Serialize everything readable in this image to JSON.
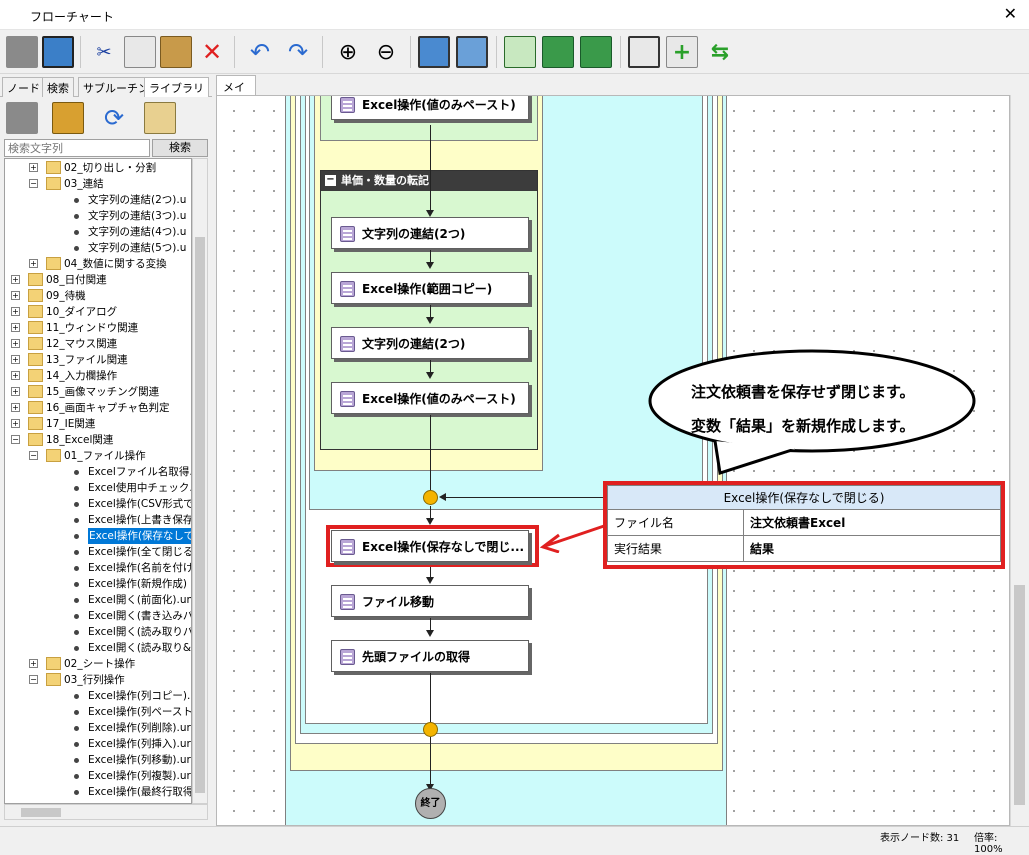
{
  "window": {
    "title": "フローチャート",
    "close": "✕"
  },
  "toolbar": {
    "icons": [
      "property-icon",
      "image-icon",
      "cut-icon",
      "copy-icon",
      "paste-icon",
      "delete-icon",
      "undo-icon",
      "redo-icon",
      "zoom-in-icon",
      "zoom-out-icon",
      "image-edit-icon",
      "image-swap-icon",
      "comment-icon",
      "export-icon",
      "import-icon",
      "window-icon",
      "add-node-icon",
      "swap-icon"
    ]
  },
  "left_tabs": [
    "ノード",
    "検索",
    "サブルーチン",
    "ライブラリ"
  ],
  "active_left_tab": "ライブラリ",
  "search": {
    "placeholder": "検索文字列",
    "button": "検索"
  },
  "tree": [
    {
      "d": 1,
      "t": "f",
      "e": "+",
      "l": "02_切り出し・分割"
    },
    {
      "d": 1,
      "t": "f",
      "e": "-",
      "l": "03_連結"
    },
    {
      "d": 2,
      "t": "n",
      "l": "文字列の連結(2つ).u"
    },
    {
      "d": 2,
      "t": "n",
      "l": "文字列の連結(3つ).u"
    },
    {
      "d": 2,
      "t": "n",
      "l": "文字列の連結(4つ).u"
    },
    {
      "d": 2,
      "t": "n",
      "l": "文字列の連結(5つ).u"
    },
    {
      "d": 1,
      "t": "f",
      "e": "+",
      "l": "04_数値に関する変換"
    },
    {
      "d": 0,
      "t": "f",
      "e": "+",
      "l": "08_日付関連"
    },
    {
      "d": 0,
      "t": "f",
      "e": "+",
      "l": "09_待機"
    },
    {
      "d": 0,
      "t": "f",
      "e": "+",
      "l": "10_ダイアログ"
    },
    {
      "d": 0,
      "t": "f",
      "e": "+",
      "l": "11_ウィンドウ関連"
    },
    {
      "d": 0,
      "t": "f",
      "e": "+",
      "l": "12_マウス関連"
    },
    {
      "d": 0,
      "t": "f",
      "e": "+",
      "l": "13_ファイル関連"
    },
    {
      "d": 0,
      "t": "f",
      "e": "+",
      "l": "14_入力欄操作"
    },
    {
      "d": 0,
      "t": "f",
      "e": "+",
      "l": "15_画像マッチング関連"
    },
    {
      "d": 0,
      "t": "f",
      "e": "+",
      "l": "16_画面キャプチャ色判定"
    },
    {
      "d": 0,
      "t": "f",
      "e": "+",
      "l": "17_IE関連"
    },
    {
      "d": 0,
      "t": "f",
      "e": "-",
      "l": "18_Excel関連"
    },
    {
      "d": 1,
      "t": "f",
      "e": "-",
      "l": "01_ファイル操作"
    },
    {
      "d": 2,
      "t": "n",
      "l": "Excelファイル名取得.ur"
    },
    {
      "d": 2,
      "t": "n",
      "l": "Excel使用中チェック.ur"
    },
    {
      "d": 2,
      "t": "n",
      "l": "Excel操作(CSV形式で"
    },
    {
      "d": 2,
      "t": "n",
      "l": "Excel操作(上書き保存"
    },
    {
      "d": 2,
      "t": "n",
      "l": "Excel操作(保存なしで",
      "sel": true
    },
    {
      "d": 2,
      "t": "n",
      "l": "Excel操作(全て閉じる)"
    },
    {
      "d": 2,
      "t": "n",
      "l": "Excel操作(名前を付け"
    },
    {
      "d": 2,
      "t": "n",
      "l": "Excel操作(新規作成)"
    },
    {
      "d": 2,
      "t": "n",
      "l": "Excel開く(前面化).um"
    },
    {
      "d": 2,
      "t": "n",
      "l": "Excel開く(書き込みパ"
    },
    {
      "d": 2,
      "t": "n",
      "l": "Excel開く(読み取りパ"
    },
    {
      "d": 2,
      "t": "n",
      "l": "Excel開く(読み取り&"
    },
    {
      "d": 1,
      "t": "f",
      "e": "+",
      "l": "02_シート操作"
    },
    {
      "d": 1,
      "t": "f",
      "e": "-",
      "l": "03_行列操作"
    },
    {
      "d": 2,
      "t": "n",
      "l": "Excel操作(列コピー).u"
    },
    {
      "d": 2,
      "t": "n",
      "l": "Excel操作(列ペースト)"
    },
    {
      "d": 2,
      "t": "n",
      "l": "Excel操作(列削除).ur"
    },
    {
      "d": 2,
      "t": "n",
      "l": "Excel操作(列挿入).ur"
    },
    {
      "d": 2,
      "t": "n",
      "l": "Excel操作(列移動).ur"
    },
    {
      "d": 2,
      "t": "n",
      "l": "Excel操作(列複製).ur"
    },
    {
      "d": 2,
      "t": "n",
      "l": "Excel操作(最終行取得"
    }
  ],
  "main_tab": "メイン",
  "flow": {
    "node_top": "Excel操作(値のみペースト)",
    "group_label": "単価・数量の転記",
    "group_collapse": "−",
    "g1": "文字列の連結(2つ)",
    "g2": "Excel操作(範囲コピー)",
    "g3": "文字列の連結(2つ)",
    "g4": "Excel操作(値のみペースト)",
    "n_close": "Excel操作(保存なしで閉じ...",
    "n_move": "ファイル移動",
    "n_first": "先頭ファイルの取得",
    "end": "終了"
  },
  "callout": {
    "line1": "注文依頼書を保存せず閉じます。",
    "line2": "変数「結果」を新規作成します。"
  },
  "props": {
    "title": "Excel操作(保存なしで閉じる)",
    "rows": [
      {
        "k": "ファイル名",
        "v": "注文依頼書Excel"
      },
      {
        "k": "実行結果",
        "v": "結果"
      }
    ]
  },
  "status": {
    "nodes": "表示ノード数: 31",
    "zoom": "倍率: 100%"
  },
  "colors": {
    "cyan": "#ccfbfb",
    "green": "#d8f8d0",
    "yellow": "#fefec8",
    "highlight": "#e02020",
    "selection": "#0078d7"
  }
}
